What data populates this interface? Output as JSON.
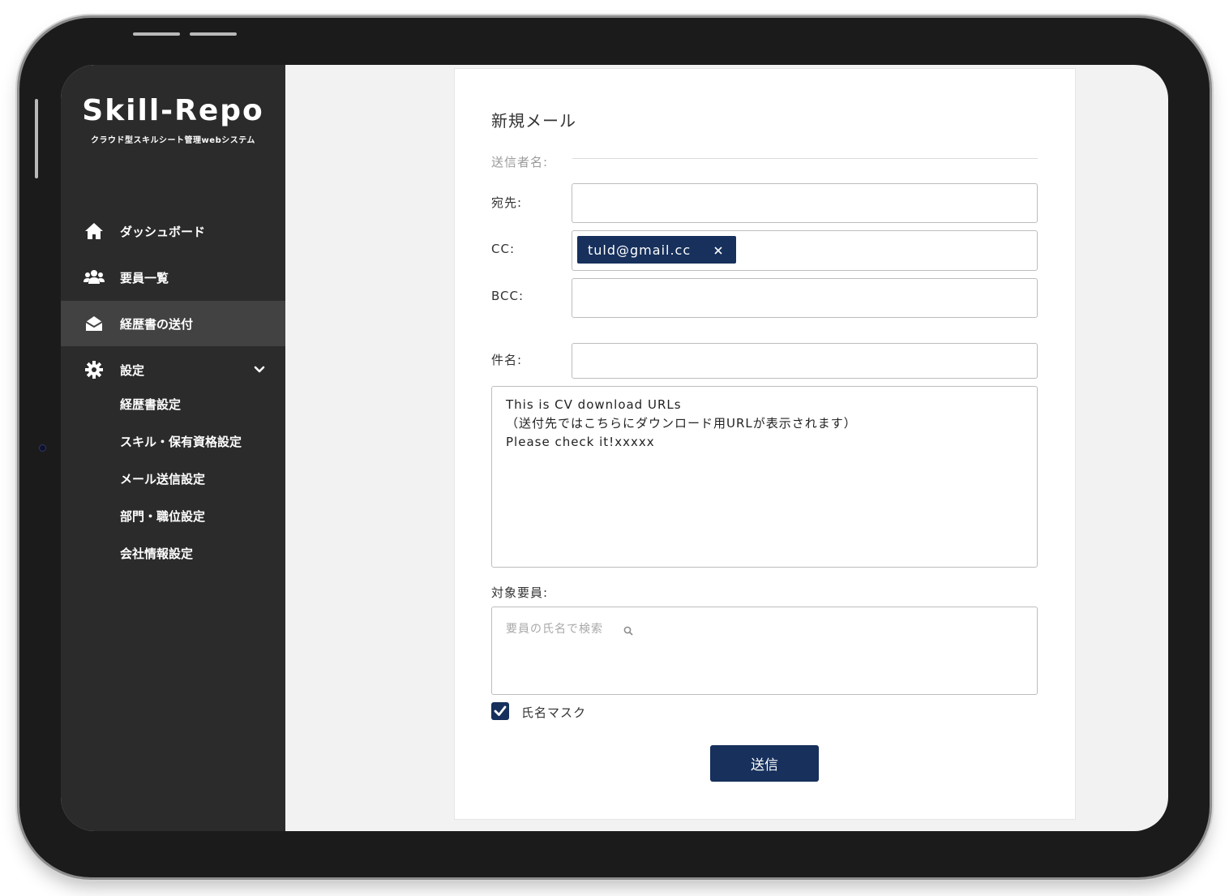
{
  "app": {
    "title": "Skill-Repo",
    "subtitle": "クラウド型スキルシート管理webシステム"
  },
  "sidebar": {
    "items": [
      {
        "label": "ダッシュボード",
        "icon": "home-icon"
      },
      {
        "label": "要員一覧",
        "icon": "users-icon"
      },
      {
        "label": "経歴書の送付",
        "icon": "envelope-open-icon",
        "active": true
      },
      {
        "label": "設定",
        "icon": "gear-icon",
        "expanded": true
      }
    ],
    "settings_sub": [
      "経歴書設定",
      "スキル・保有資格設定",
      "メール送信設定",
      "部門・職位設定",
      "会社情報設定"
    ]
  },
  "form": {
    "title": "新規メール",
    "sender_label": "送信者名:",
    "to_label": "宛先:",
    "to_value": "",
    "cc_label": "CC:",
    "cc_chips": [
      "tuld@gmail.cc"
    ],
    "bcc_label": "BCC:",
    "bcc_value": "",
    "subject_label": "件名:",
    "subject_value": "",
    "body_lines": [
      "This is CV download URLs",
      "（送付先ではこちらにダウンロード用URLが表示されます）",
      "Please check it!xxxxx"
    ],
    "target_label": "対象要員:",
    "search_placeholder": "要員の氏名で検索",
    "mask_label": "氏名マスク",
    "mask_checked": true,
    "send_label": "送信"
  },
  "colors": {
    "sidebar_bg": "#2b2b2b",
    "sidebar_active": "#424242",
    "accent": "#17305c",
    "content_bg": "#f2f2f2"
  }
}
